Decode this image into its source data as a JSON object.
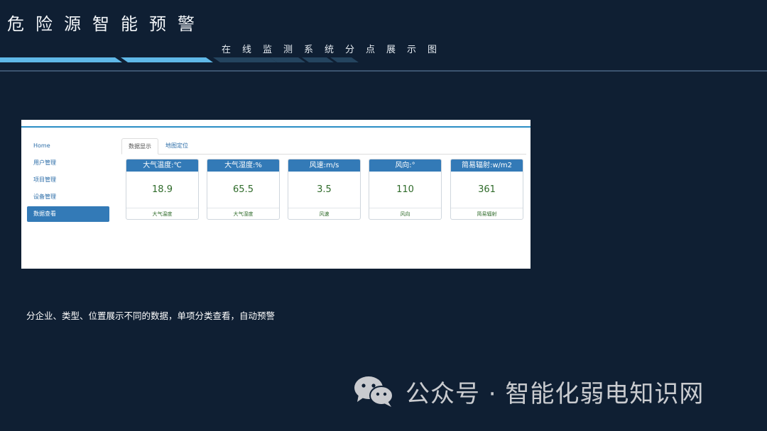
{
  "header": {
    "title": "危险源智能预警",
    "subtitle": "在线监测系统分点展示图"
  },
  "screen": {
    "nav": [
      {
        "label": "Home",
        "active": false
      },
      {
        "label": "用户管理",
        "active": false
      },
      {
        "label": "项目管理",
        "active": false
      },
      {
        "label": "设备管理",
        "active": false
      },
      {
        "label": "数据查看",
        "active": true
      }
    ],
    "tabs": [
      {
        "label": "数据显示",
        "active": true
      },
      {
        "label": "地图定位",
        "active": false
      }
    ],
    "cards": [
      {
        "title": "大气温度:℃",
        "value": "18.9",
        "footer": "大气温度"
      },
      {
        "title": "大气湿度:%",
        "value": "65.5",
        "footer": "大气湿度"
      },
      {
        "title": "风速:m/s",
        "value": "3.5",
        "footer": "风速"
      },
      {
        "title": "风向:°",
        "value": "110",
        "footer": "风向"
      },
      {
        "title": "简易辐射:w/m2",
        "value": "361",
        "footer": "简易辐射"
      }
    ]
  },
  "caption": "分企业、类型、位置展示不同的数据，单项分类查看，自动预警",
  "watermark": {
    "icon": "wechat-icon",
    "text": "公众号 · 智能化弱电知识网"
  },
  "colors": {
    "background": "#0f1f33",
    "accent": "#337ab7",
    "value_text": "#2f6b2a",
    "deco_bar": "#5fb8e8"
  }
}
